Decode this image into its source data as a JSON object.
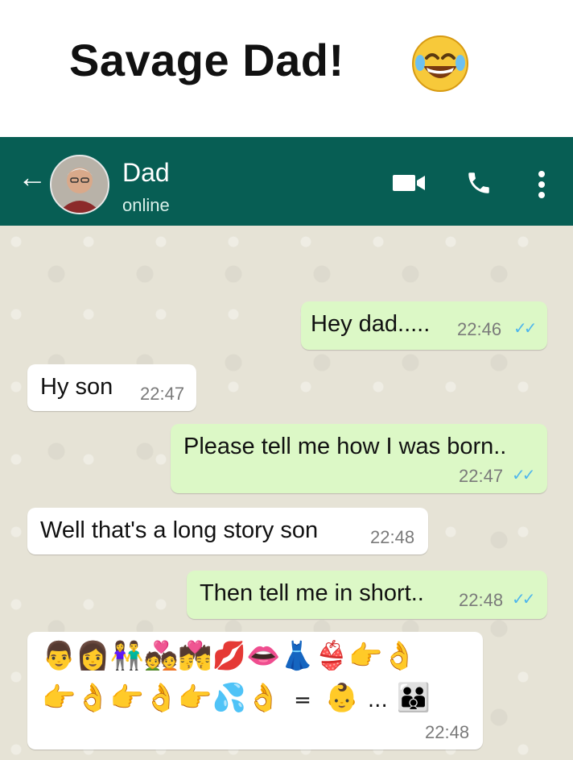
{
  "meme": {
    "title": "Savage Dad!",
    "emoji_icon": "laughing-face-emoji"
  },
  "header": {
    "back_icon": "arrow-left-icon",
    "back_glyph": "←",
    "contact_name": "Dad",
    "status": "online",
    "video_icon": "video-camera-icon",
    "call_icon": "phone-icon",
    "menu_icon": "more-vertical-icon",
    "color": "#075e54"
  },
  "messages": [
    {
      "direction": "outgoing",
      "text": "Hey dad.....",
      "time": "22:46",
      "read": true
    },
    {
      "direction": "incoming",
      "text": "Hy son",
      "time": "22:47"
    },
    {
      "direction": "outgoing",
      "text": "Please tell me how I was born..",
      "time": "22:47",
      "read": true
    },
    {
      "direction": "incoming",
      "text": "Well that's a long story son",
      "time": "22:48"
    },
    {
      "direction": "outgoing",
      "text": "Then tell me in short..",
      "time": "22:48",
      "read": true
    },
    {
      "direction": "incoming",
      "emoji_line1": "👨👩👫💑💏💋👄👗👙👉👌",
      "emoji_line2": "👉👌👉👌👉💦👌",
      "equals": "=",
      "baby": "👶",
      "ellipsis": "...",
      "family": "👪",
      "time": "22:48"
    }
  ],
  "ticks": "✓✓",
  "colors": {
    "outgoing_bubble": "#dcf8c6",
    "incoming_bubble": "#ffffff",
    "read_tick": "#4fb6ec",
    "chat_bg": "#e6e3d6"
  }
}
